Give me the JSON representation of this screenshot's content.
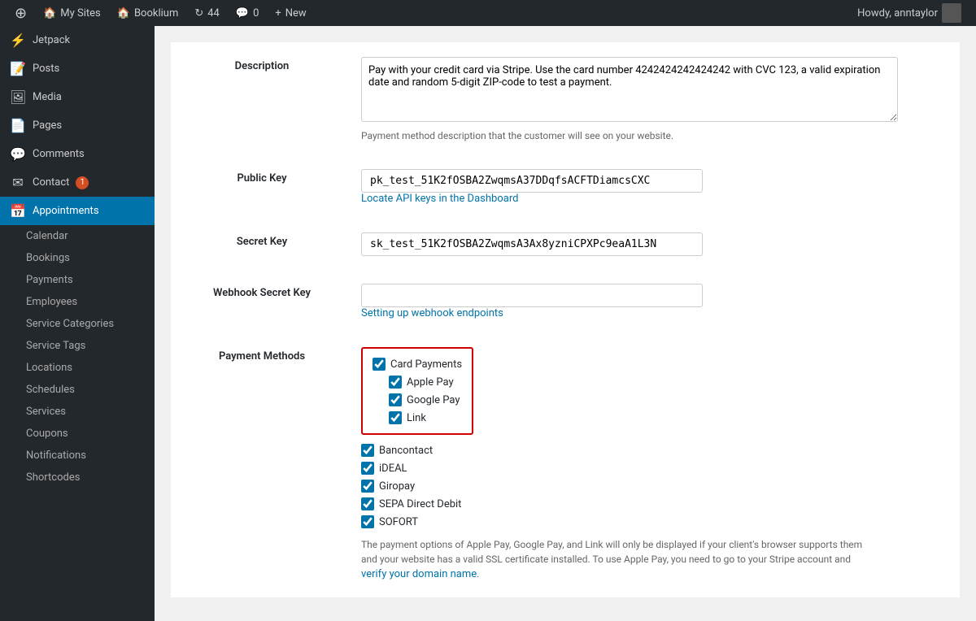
{
  "adminbar": {
    "wp_logo": "⊕",
    "items": [
      {
        "label": "My Sites",
        "icon": "🏠"
      },
      {
        "label": "Booklium",
        "icon": "🏠"
      },
      {
        "label": "44",
        "icon": "↻"
      },
      {
        "label": "0",
        "icon": "💬"
      },
      {
        "label": "New",
        "icon": "+"
      }
    ],
    "right": "Howdy, anntaylor"
  },
  "sidebar": {
    "menu_items": [
      {
        "id": "jetpack",
        "label": "Jetpack",
        "icon": "⚡"
      },
      {
        "id": "posts",
        "label": "Posts",
        "icon": "📝"
      },
      {
        "id": "media",
        "label": "Media",
        "icon": "🖼"
      },
      {
        "id": "pages",
        "label": "Pages",
        "icon": "📄"
      },
      {
        "id": "comments",
        "label": "Comments",
        "icon": "💬"
      },
      {
        "id": "contact",
        "label": "Contact",
        "icon": "✉",
        "badge": "1"
      },
      {
        "id": "appointments",
        "label": "Appointments",
        "icon": "📅",
        "active": true
      }
    ],
    "submenu_items": [
      {
        "id": "calendar",
        "label": "Calendar"
      },
      {
        "id": "bookings",
        "label": "Bookings"
      },
      {
        "id": "payments",
        "label": "Payments"
      },
      {
        "id": "employees",
        "label": "Employees"
      },
      {
        "id": "service-categories",
        "label": "Service Categories"
      },
      {
        "id": "service-tags",
        "label": "Service Tags"
      },
      {
        "id": "locations",
        "label": "Locations"
      },
      {
        "id": "schedules",
        "label": "Schedules"
      },
      {
        "id": "services",
        "label": "Services"
      },
      {
        "id": "coupons",
        "label": "Coupons"
      },
      {
        "id": "notifications",
        "label": "Notifications"
      },
      {
        "id": "shortcodes",
        "label": "Shortcodes"
      }
    ]
  },
  "form": {
    "description": {
      "label": "Description",
      "value": "Pay with your credit card via Stripe. Use the card number 4242424242424242 with CVC 123, a valid expiration date and random 5-digit ZIP-code to test a payment.",
      "hint": "Payment method description that the customer will see on your website."
    },
    "public_key": {
      "label": "Public Key",
      "value": "pk_test_51K2fOSBA2ZwqmsA37DDqfsACFTDiamcsCXC",
      "link_text": "Locate API keys in the Dashboard",
      "link_href": "#"
    },
    "secret_key": {
      "label": "Secret Key",
      "value": "sk_test_51K2fOSBA2ZwqmsA3Ax8yzniCPXPc9eaA1L3N"
    },
    "webhook_secret_key": {
      "label": "Webhook Secret Key",
      "value": "",
      "link_text": "Setting up webhook endpoints",
      "link_href": "#"
    },
    "payment_methods": {
      "label": "Payment Methods",
      "highlighted": [
        {
          "id": "card-payments",
          "label": "Card Payments",
          "checked": true,
          "indent": false
        },
        {
          "id": "apple-pay",
          "label": "Apple Pay",
          "checked": true,
          "indent": true
        },
        {
          "id": "google-pay",
          "label": "Google Pay",
          "checked": true,
          "indent": true
        },
        {
          "id": "link",
          "label": "Link",
          "checked": true,
          "indent": true
        }
      ],
      "regular": [
        {
          "id": "bancontact",
          "label": "Bancontact",
          "checked": true
        },
        {
          "id": "ideal",
          "label": "iDEAL",
          "checked": true
        },
        {
          "id": "giropay",
          "label": "Giropay",
          "checked": true
        },
        {
          "id": "sepa",
          "label": "SEPA Direct Debit",
          "checked": true
        },
        {
          "id": "sofort",
          "label": "SOFORT",
          "checked": true
        }
      ],
      "note": "The payment options of Apple Pay, Google Pay, and Link will only be displayed if your client's browser supports them and your website has a valid SSL certificate installed. To use Apple Pay, you need to go to your Stripe account and ",
      "note_link_text": "verify your domain name",
      "note_link_href": "#",
      "note_suffix": "."
    }
  }
}
